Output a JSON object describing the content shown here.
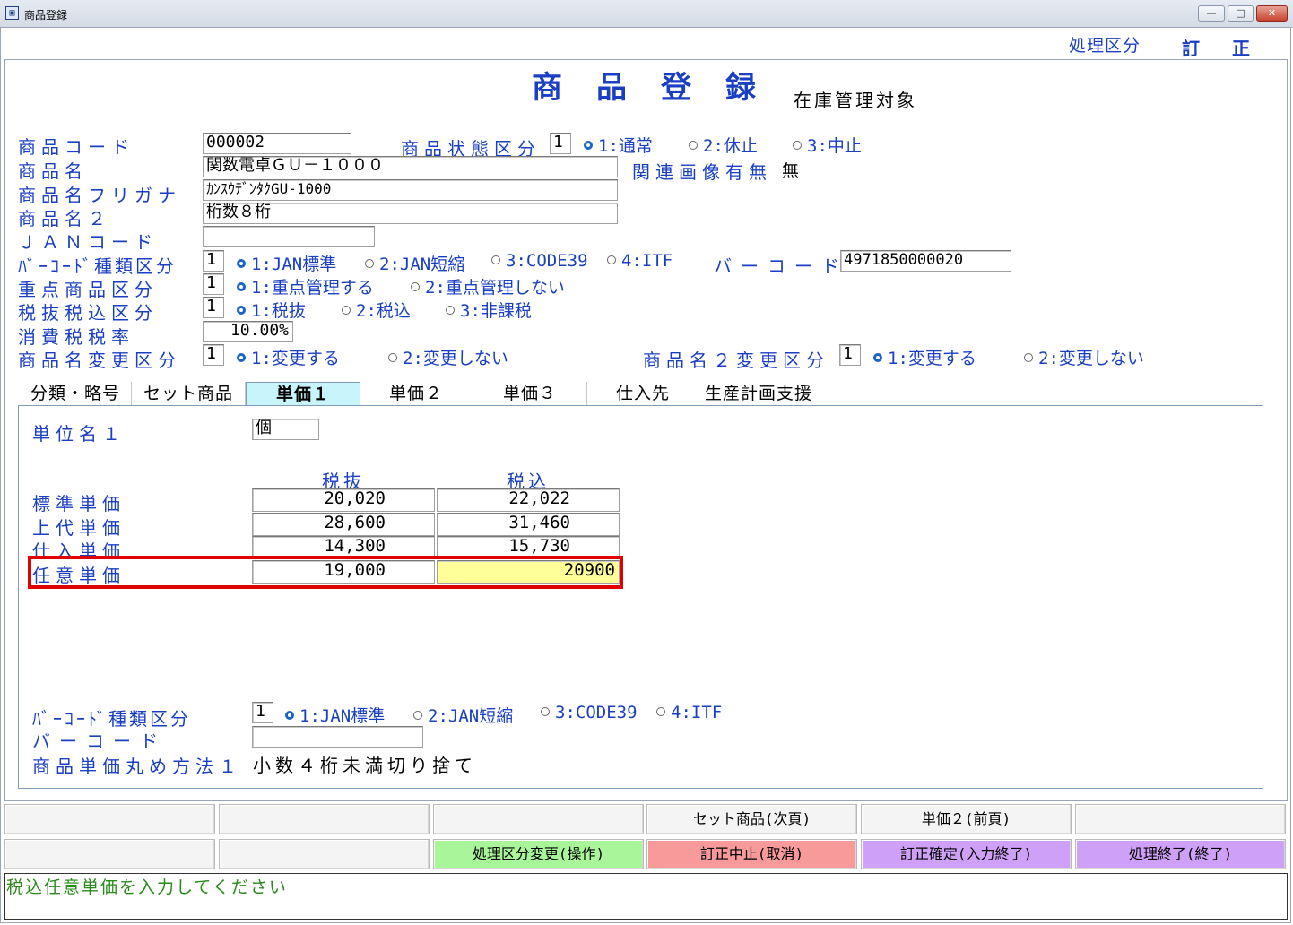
{
  "window": {
    "title": "商品登録",
    "min": "—",
    "max": "□",
    "close": "✕"
  },
  "header": {
    "mode_label": "処理区分",
    "mode_value": "訂正",
    "title": "商品登録",
    "subtitle": "在庫管理対象"
  },
  "form": {
    "product_code": {
      "label": "商品コード",
      "value": "000002"
    },
    "status": {
      "label": "商品状態区分",
      "value": "1",
      "options": [
        "1:通常",
        "2:休止",
        "3:中止"
      ],
      "selected": 0
    },
    "product_name": {
      "label": "商品名",
      "value": "関数電卓ＧＵ－１０００"
    },
    "related_image": {
      "label": "関連画像有無",
      "value": "無"
    },
    "furigana": {
      "label": "商品名フリガナ",
      "value": "ｶﾝｽｳﾃﾞﾝﾀｸGU-1000"
    },
    "product_name2": {
      "label": "商品名２",
      "value": "桁数８桁"
    },
    "jan_code": {
      "label": "ＪＡＮコード",
      "value": ""
    },
    "barcode_type": {
      "label": "ﾊﾞｰｺｰﾄﾞ種類区分",
      "value": "1",
      "options": [
        "1:JAN標準",
        "2:JAN短縮",
        "3:CODE39",
        "4:ITF"
      ],
      "selected": 0
    },
    "barcode": {
      "label": "バーコード",
      "value": "4971850000020"
    },
    "priority": {
      "label": "重点商品区分",
      "value": "1",
      "options": [
        "1:重点管理する",
        "2:重点管理しない"
      ],
      "selected": 0
    },
    "tax_type": {
      "label": "税抜税込区分",
      "value": "1",
      "options": [
        "1:税抜",
        "2:税込",
        "3:非課税"
      ],
      "selected": 0
    },
    "tax_rate": {
      "label": "消費税税率",
      "value": "10.00%"
    },
    "name_change": {
      "label": "商品名変更区分",
      "value": "1",
      "options": [
        "1:変更する",
        "2:変更しない"
      ],
      "selected": 0
    },
    "name2_change": {
      "label": "商品名２変更区分",
      "value": "1",
      "options": [
        "1:変更する",
        "2:変更しない"
      ],
      "selected": 0
    }
  },
  "tabs": [
    "分類・略号",
    "セット商品",
    "単価１",
    "単価２",
    "単価３",
    "仕入先",
    "生産計画支援"
  ],
  "active_tab": 2,
  "price_panel": {
    "unit_name_label": "単位名１",
    "unit_name_value": "個",
    "col_headers": [
      "税抜",
      "税込"
    ],
    "rows": [
      {
        "label": "標準単価",
        "excl": "20,020",
        "incl": "22,022"
      },
      {
        "label": "上代単価",
        "excl": "28,600",
        "incl": "31,460"
      },
      {
        "label": "仕入単価",
        "excl": "14,300",
        "incl": "15,730"
      },
      {
        "label": "任意単価",
        "excl": "19,000",
        "incl": "20900"
      }
    ],
    "barcode_type": {
      "label": "ﾊﾞｰｺｰﾄﾞ種類区分",
      "value": "1",
      "options": [
        "1:JAN標準",
        "2:JAN短縮",
        "3:CODE39",
        "4:ITF"
      ],
      "selected": 0
    },
    "barcode": {
      "label": "バーコード",
      "value": ""
    },
    "rounding": {
      "label": "商品単価丸め方法１",
      "value": "小数４桁未満切り捨て"
    }
  },
  "function_keys": {
    "row1": [
      "",
      "",
      "",
      "セット商品(次頁)",
      "単価２(前頁)",
      ""
    ],
    "row2": [
      "",
      "",
      "処理区分変更(操作)",
      "訂正中止(取消)",
      "訂正確定(入力終了)",
      "処理終了(終了)"
    ]
  },
  "status_message": "税込任意単価を入力してください",
  "colors": {
    "label_blue": "#1b3fc2",
    "highlight_input": "#ffff99",
    "focus_border": "#e00000",
    "fk_green": "#a8f59a",
    "fk_red": "#f99a9a",
    "fk_purple": "#cfa0f7",
    "status_green": "#2a8a1c"
  }
}
